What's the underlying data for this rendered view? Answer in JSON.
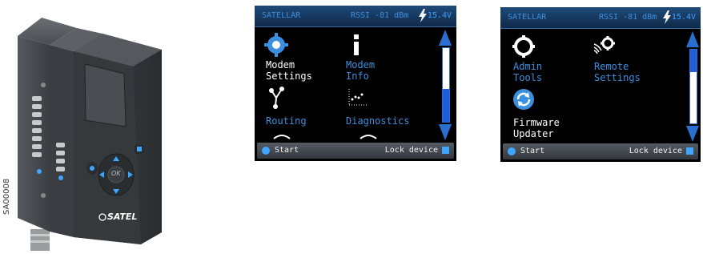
{
  "device": {
    "brand": "SATEL",
    "ok_label": "OK",
    "side_code": "SA00008"
  },
  "screen1": {
    "status": {
      "brand": "SATELLAR",
      "rssi": "RSSI -81 dBm",
      "voltage": "15.4V"
    },
    "tiles": [
      {
        "label": "Modem\nSettings",
        "icon": "gear-icon",
        "highlighted": true
      },
      {
        "label": "Modem\nInfo",
        "icon": "info-icon",
        "highlighted": false
      },
      {
        "label": "Routing",
        "icon": "routing-icon",
        "highlighted": false
      },
      {
        "label": "Diagnostics",
        "icon": "diagnostics-icon",
        "highlighted": false
      }
    ],
    "scroll_position": 0.55,
    "bottom": {
      "start_label": "Start",
      "lock_label": "Lock device"
    }
  },
  "screen2": {
    "status": {
      "brand": "SATELLAR",
      "rssi": "RSSI -81 dBm",
      "voltage": "15.4V"
    },
    "tiles": [
      {
        "label": "Admin\nTools",
        "icon": "gear-icon",
        "highlighted": false
      },
      {
        "label": "Remote\nSettings",
        "icon": "remote-settings-icon",
        "highlighted": false
      },
      {
        "label": "Firmware\nUpdater",
        "icon": "refresh-icon",
        "highlighted": true
      }
    ],
    "scroll_position": 0.75,
    "bottom": {
      "start_label": "Start",
      "lock_label": "Lock device"
    }
  },
  "colors": {
    "accent": "#3c8fdf",
    "screen_bg": "#000000",
    "text_white": "#ffffff"
  }
}
